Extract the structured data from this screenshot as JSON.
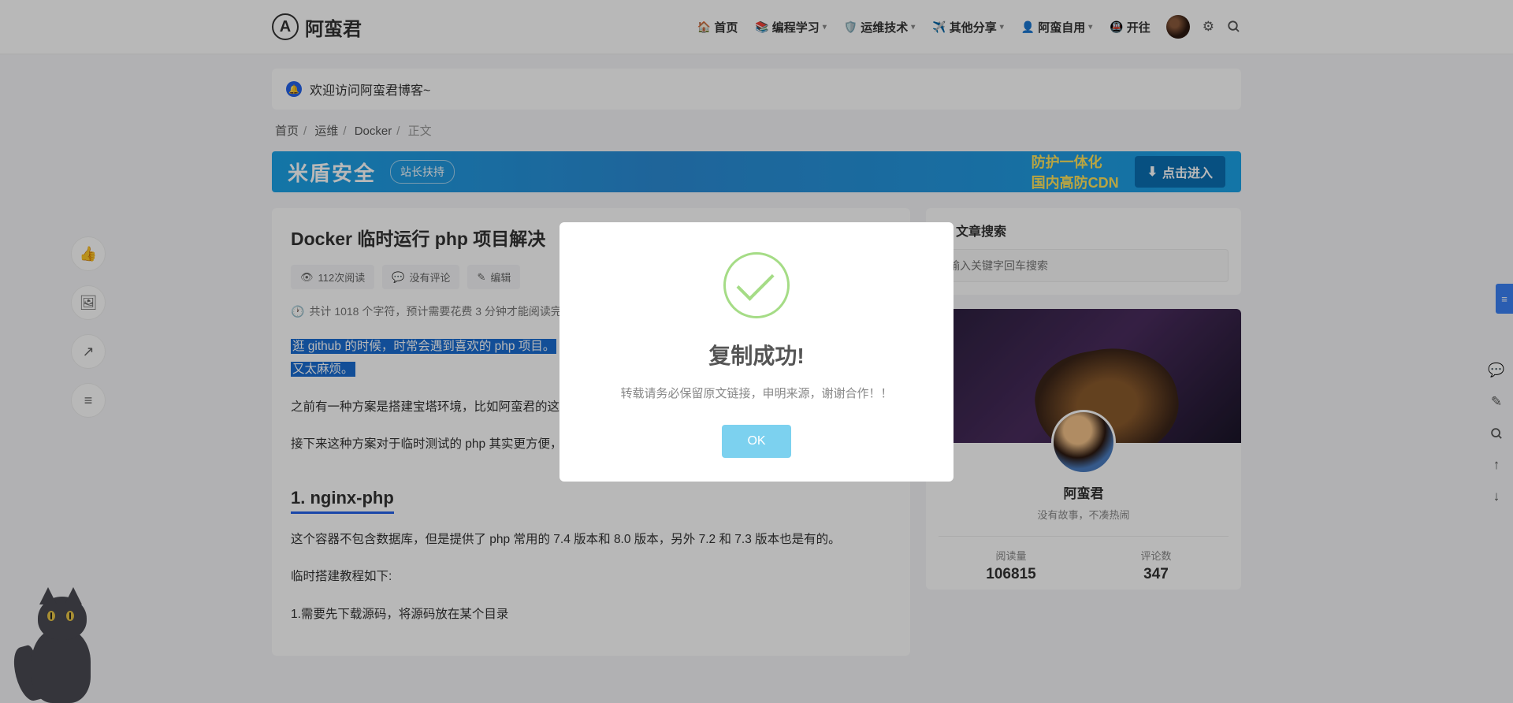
{
  "site": {
    "name": "阿蛮君"
  },
  "nav": {
    "items": [
      {
        "label": "首页"
      },
      {
        "label": "编程学习"
      },
      {
        "label": "运维技术"
      },
      {
        "label": "其他分享"
      },
      {
        "label": "阿蛮自用"
      },
      {
        "label": "开往"
      }
    ]
  },
  "notice": {
    "text": "欢迎访问阿蛮君博客~"
  },
  "breadcrumb": {
    "items": [
      "首页",
      "运维",
      "Docker"
    ],
    "current": "正文"
  },
  "banner": {
    "brand": "米盾安全",
    "tag": "站长扶持",
    "line1": "防护一体化",
    "line2": "国内高防CDN",
    "cta": "点击进入"
  },
  "article": {
    "title": "Docker 临时运行 php 项目解决",
    "meta": {
      "reads": "112次阅读",
      "comments": "没有评论",
      "edit": "编辑"
    },
    "info": "共计 1018 个字符，预计需要花费 3 分钟才能阅读完",
    "p1a": "逛 github 的时候，时常会遇到喜欢的 php 项目。",
    "p1b": "又太麻烦。",
    "p2": "之前有一种方案是搭建宝塔环境，比如阿蛮君的这篇",
    "p3": "接下来这种方案对于临时测试的 php 其实更方便，不过如果想要长期运行，建议还是不要用这种方式。",
    "h2": "1. nginx-php",
    "p4": "这个容器不包含数据库，但是提供了 php 常用的 7.4 版本和 8.0 版本，另外 7.2 和 7.3 版本也是有的。",
    "p5": "临时搭建教程如下:",
    "p6": "1.需要先下载源码，将源码放在某个目录"
  },
  "sidebar": {
    "search_title": "文章搜索",
    "search_placeholder": "输入关键字回车搜索",
    "profile": {
      "name": "阿蛮君",
      "bio": "没有故事，不凑热闹",
      "stats": [
        {
          "label": "阅读量",
          "value": "106815"
        },
        {
          "label": "评论数",
          "value": "347"
        }
      ]
    }
  },
  "modal": {
    "title": "复制成功!",
    "text": "转载请务必保留原文链接，申明来源，谢谢合作！！",
    "ok": "OK"
  }
}
